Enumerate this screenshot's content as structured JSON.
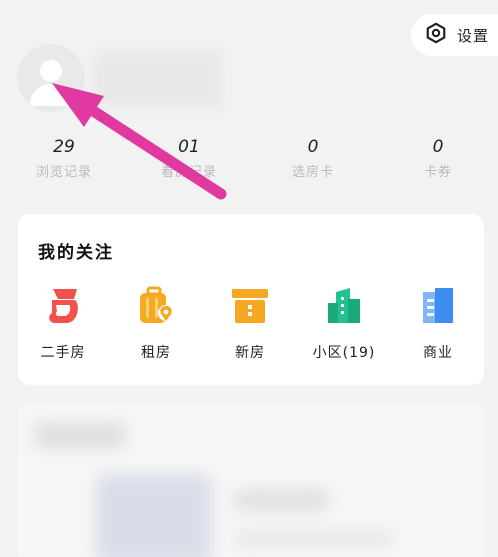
{
  "header": {
    "settings_label": "设置"
  },
  "stats": [
    {
      "value": "29",
      "label": "浏览记录"
    },
    {
      "value": "01",
      "label": "看房记录"
    },
    {
      "value": "0",
      "label": "选房卡"
    },
    {
      "value": "0",
      "label": "卡券"
    }
  ],
  "follow": {
    "title": "我的关注",
    "items": [
      {
        "label": "二手房",
        "icon": "secondhand-house-icon"
      },
      {
        "label": "租房",
        "icon": "rent-luggage-icon"
      },
      {
        "label": "新房",
        "icon": "new-house-box-icon"
      },
      {
        "label": "小区(19)",
        "icon": "community-building-icon"
      },
      {
        "label": "商业",
        "icon": "commercial-building-icon"
      }
    ]
  },
  "colors": {
    "annotation_arrow": "#e03aa0",
    "secondhand": "#f2504b",
    "rent": "#f7a823",
    "new_house": "#f7a823",
    "community": "#21c28e",
    "commercial": "#3d8ef0"
  }
}
